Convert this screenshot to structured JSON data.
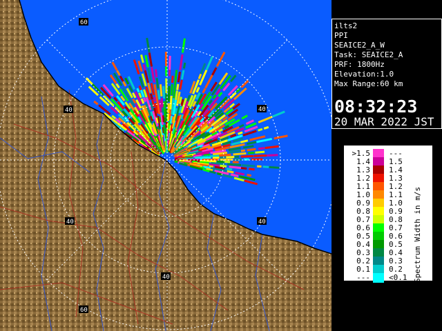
{
  "info": {
    "lines": [
      "ilts2",
      "PPI",
      "SEAICE2_A_W",
      "Task: SEAICE2_A",
      "PRF: 1800Hz",
      "Elevation:1.0",
      "Max Range:60 km"
    ],
    "time": "08:32:23",
    "date": "20 MAR 2022 JST"
  },
  "range_labels": [
    "60",
    "40",
    "40",
    "40",
    "40",
    "40",
    "60"
  ],
  "legend": {
    "title": "Spectrum Width in m/s",
    "rows": [
      {
        "lo": ">1.5",
        "hi": "---",
        "color": "#ff33cc"
      },
      {
        "lo": "1.4",
        "hi": "1.5",
        "color": "#cc0099"
      },
      {
        "lo": "1.3",
        "hi": "1.4",
        "color": "#aa0000"
      },
      {
        "lo": "1.2",
        "hi": "1.3",
        "color": "#ee1100"
      },
      {
        "lo": "1.1",
        "hi": "1.2",
        "color": "#ff5500"
      },
      {
        "lo": "1.0",
        "hi": "1.1",
        "color": "#ff8800"
      },
      {
        "lo": "0.9",
        "hi": "1.0",
        "color": "#ffcc00"
      },
      {
        "lo": "0.8",
        "hi": "0.9",
        "color": "#ffff00"
      },
      {
        "lo": "0.7",
        "hi": "0.8",
        "color": "#ccff00"
      },
      {
        "lo": "0.6",
        "hi": "0.7",
        "color": "#00ff00"
      },
      {
        "lo": "0.5",
        "hi": "0.6",
        "color": "#00cc00"
      },
      {
        "lo": "0.4",
        "hi": "0.5",
        "color": "#009900"
      },
      {
        "lo": "0.3",
        "hi": "0.4",
        "color": "#008844"
      },
      {
        "lo": "0.2",
        "hi": "0.3",
        "color": "#008888"
      },
      {
        "lo": "0.1",
        "hi": "0.2",
        "color": "#00cccc"
      },
      {
        "lo": "---",
        "hi": "<0.1",
        "color": "#00ffff"
      }
    ]
  },
  "colors": {
    "sea": "#0a5cff",
    "land": "#8a6a3a",
    "coast": "#000000",
    "river": "#3355cc",
    "road": "#aa3322",
    "range_ring": "#ffffff"
  }
}
